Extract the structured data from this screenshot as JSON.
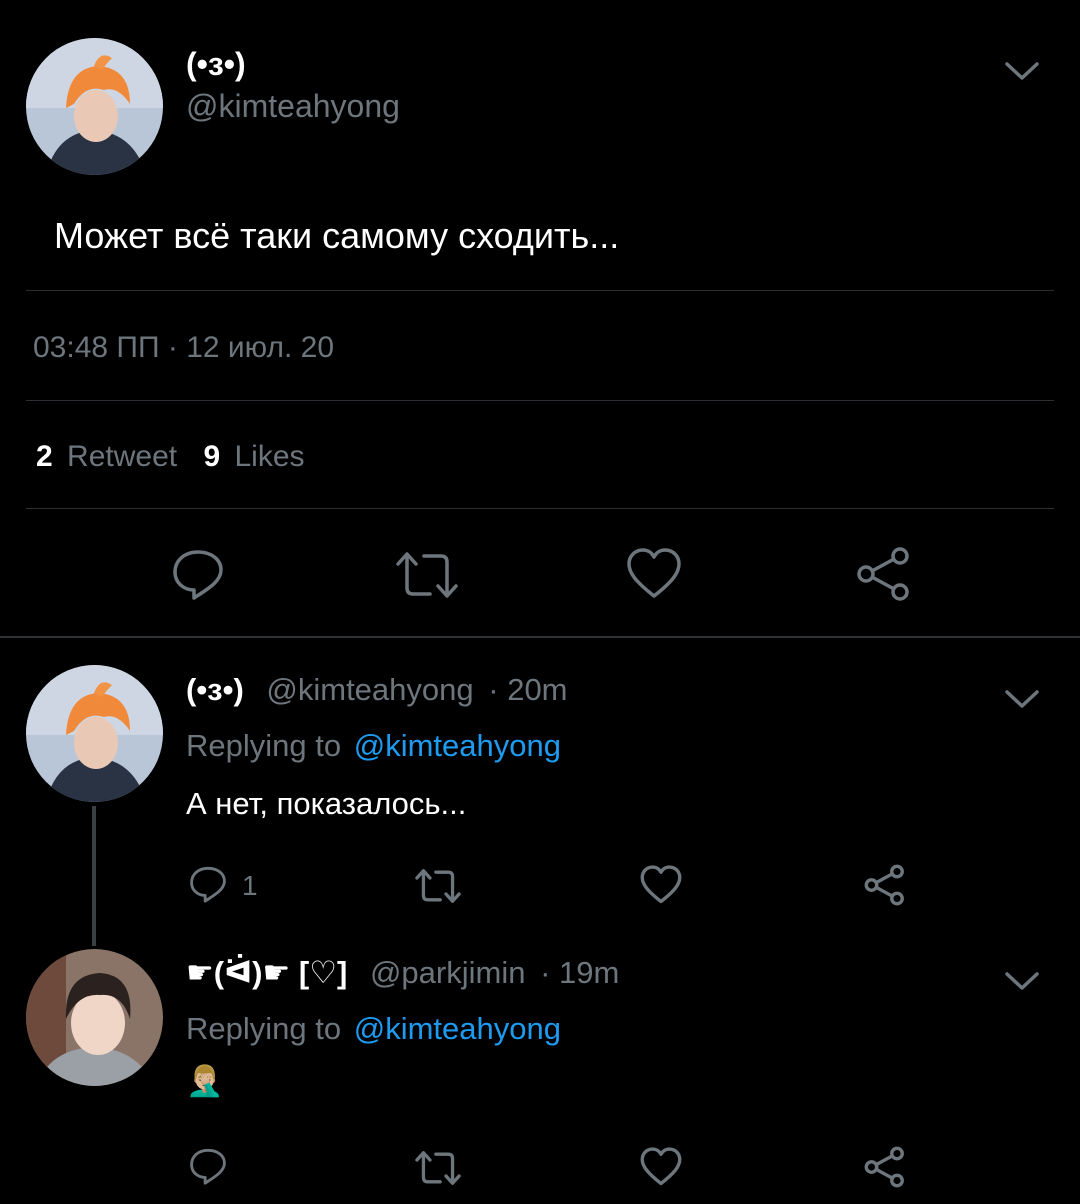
{
  "tweet": {
    "display_name": "(•з•)",
    "handle": "@kimteahyong",
    "text": "Может всё таки самому сходить...",
    "timestamp": "03:48 ПП · 12 июл. 20",
    "retweet_count": "2",
    "retweet_label": "Retweet",
    "like_count": "9",
    "like_label": "Likes",
    "avatar_icon": "avatar-orange-hair",
    "actions": [
      "reply-icon",
      "retweet-icon",
      "like-icon",
      "share-icon"
    ]
  },
  "replies": [
    {
      "display_name": "(•з•)",
      "handle": "@kimteahyong",
      "time": "· 20m",
      "replying_prefix": "Replying to",
      "replying_to": "@kimteahyong",
      "text": "А нет, показалось...",
      "reply_count": "1",
      "avatar_icon": "avatar-orange-hair"
    },
    {
      "display_name": "☛(ᐛ)☛ [♡]",
      "handle": "@parkjimin",
      "time": "· 19m",
      "replying_prefix": "Replying to",
      "replying_to": "@kimteahyong",
      "text": "🤦🏼‍♂️",
      "reply_count": "",
      "avatar_icon": "avatar-dark-hair"
    }
  ],
  "colors": {
    "background": "#000000",
    "muted": "#6e767d",
    "link": "#1d9bf0",
    "divider": "#2f3336"
  }
}
